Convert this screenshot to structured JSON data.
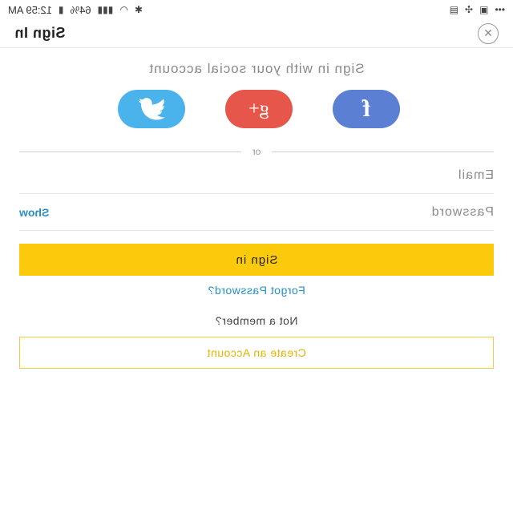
{
  "status_bar": {
    "time": "12:59 AM",
    "battery": "64%",
    "icons": [
      "bluetooth-icon",
      "wifi-icon",
      "signal-icon",
      "battery-icon",
      "image-icon",
      "fan-icon",
      "gallery-icon",
      "more-dots-icon"
    ]
  },
  "header": {
    "title": "Sign In",
    "close_icon": "close-circle-icon"
  },
  "social": {
    "caption": "Sign in with your social account",
    "buttons": [
      {
        "name": "facebook",
        "glyph": "f",
        "color": "#5b7fd3"
      },
      {
        "name": "google-plus",
        "glyph": "g+",
        "color": "#e6564b"
      },
      {
        "name": "twitter",
        "glyph": "twitter-bird-icon",
        "color": "#4ab3ec"
      }
    ]
  },
  "divider": {
    "text": "or"
  },
  "form": {
    "email_placeholder": "Email",
    "password_placeholder": "Password",
    "show_label": "Show",
    "signin_label": "Sign in",
    "forgot_label": "Forgot Password?",
    "not_member_label": "Not a member?",
    "create_label": "Create an Account"
  },
  "colors": {
    "primary_yellow": "#fbca0b",
    "link_blue": "#2a8ec9",
    "facebook": "#5b7fd3",
    "google": "#e6564b",
    "twitter": "#4ab3ec"
  }
}
